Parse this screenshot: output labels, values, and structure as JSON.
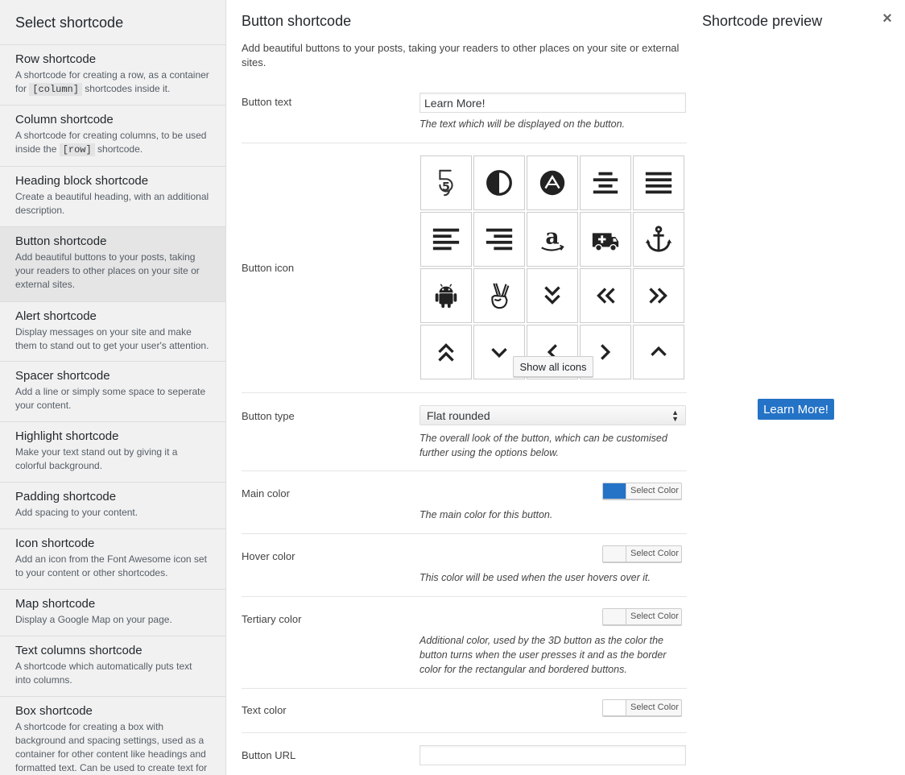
{
  "sidebar": {
    "title": "Select shortcode",
    "items": [
      {
        "name": "Row shortcode",
        "desc_before": "A shortcode for creating a row, as a container for ",
        "code": "[column]",
        "desc_after": " shortcodes inside it."
      },
      {
        "name": "Column shortcode",
        "desc_before": "A shortcode for creating columns, to be used inside the ",
        "code": "[row]",
        "desc_after": " shortcode."
      },
      {
        "name": "Heading block shortcode",
        "desc": "Create a beautiful heading, with an additional description."
      },
      {
        "name": "Button shortcode",
        "desc": "Add beautiful buttons to your posts, taking your readers to other places on your site or external sites."
      },
      {
        "name": "Alert shortcode",
        "desc": "Display messages on your site and make them to stand out to get your user's attention."
      },
      {
        "name": "Spacer shortcode",
        "desc": "Add a line or simply some space to seperate your content."
      },
      {
        "name": "Highlight shortcode",
        "desc": "Make your text stand out by giving it a colorful background."
      },
      {
        "name": "Padding shortcode",
        "desc": "Add spacing to your content."
      },
      {
        "name": "Icon shortcode",
        "desc": "Add an icon from the Font Awesome icon set to your content or other shortcodes."
      },
      {
        "name": "Map shortcode",
        "desc": "Display a Google Map on your page."
      },
      {
        "name": "Text columns shortcode",
        "desc": "A shortcode which automatically puts text into columns."
      },
      {
        "name": "Box shortcode",
        "desc": "A shortcode for creating a box with background and spacing settings, used as a container for other content like headings and formatted text. Can be used to create text for"
      }
    ]
  },
  "main": {
    "title": "Button shortcode",
    "description": "Add beautiful buttons to your posts, taking your readers to other places on your site or external sites.",
    "button_text": {
      "label": "Button text",
      "value": "Learn More!",
      "hint": "The text which will be displayed on the button."
    },
    "button_icon": {
      "label": "Button icon",
      "show_all_label": "Show all icons",
      "icons": [
        "html5-icon",
        "adjust-icon",
        "chevron-circle-up-icon",
        "align-center-icon",
        "align-justify-icon",
        "align-left-icon",
        "align-right-icon",
        "amazon-icon",
        "ambulance-icon",
        "anchor-icon",
        "android-icon",
        "victory-hand-icon",
        "double-chevron-down-icon",
        "double-chevron-left-icon",
        "double-chevron-right-icon",
        "double-chevron-up-icon",
        "chevron-down-icon",
        "chevron-left-icon",
        "chevron-right-icon",
        "chevron-up-icon"
      ]
    },
    "button_type": {
      "label": "Button type",
      "value": "Flat rounded",
      "hint": "The overall look of the button, which can be customised further using the options below."
    },
    "main_color": {
      "label": "Main color",
      "picker": "Select Color",
      "color": "#2473c6",
      "hint": "The main color for this button."
    },
    "hover_color": {
      "label": "Hover color",
      "picker": "Select Color",
      "color": "#f7f7f7",
      "hint": "This color will be used when the user hovers over it."
    },
    "tertiary_color": {
      "label": "Tertiary color",
      "picker": "Select Color",
      "color": "#f7f7f7",
      "hint": "Additional color, used by the 3D button as the color the button turns when the user presses it and as the border color for the rectangular and bordered buttons."
    },
    "text_color": {
      "label": "Text color",
      "picker": "Select Color",
      "color": "#ffffff"
    },
    "button_url": {
      "label": "Button URL",
      "value": ""
    }
  },
  "preview": {
    "title": "Shortcode preview",
    "close_glyph": "×",
    "button_label": "Learn More!",
    "button_color": "#2473c6"
  }
}
